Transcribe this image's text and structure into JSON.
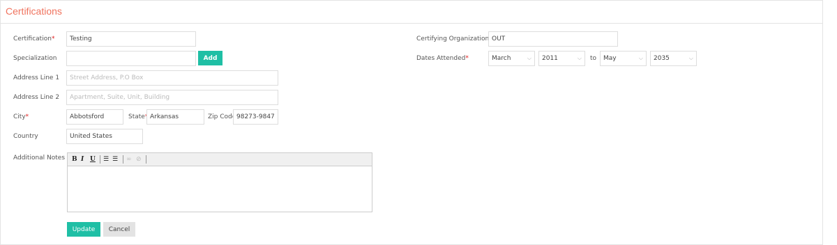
{
  "header": {
    "title": "Certifications"
  },
  "form": {
    "certification": {
      "label": "Certification",
      "value": "Testing"
    },
    "specialization": {
      "label": "Specialization",
      "value": "",
      "add_label": "Add"
    },
    "address1": {
      "label": "Address Line 1",
      "placeholder": "Street Address, P.O Box"
    },
    "address2": {
      "label": "Address Line 2",
      "placeholder": "Apartment, Suite, Unit, Building"
    },
    "city": {
      "label": "City",
      "value": "Abbotsford"
    },
    "state": {
      "label": "State",
      "value": "Arkansas"
    },
    "zip": {
      "label": "Zip Code",
      "value": "98273-9847"
    },
    "country": {
      "label": "Country",
      "value": "United States"
    },
    "notes": {
      "label": "Additional Notes"
    },
    "certifying_org": {
      "label": "Certifying Organization",
      "value": "OUT"
    },
    "dates": {
      "label": "Dates Attended",
      "from_month": "March",
      "from_year": "2011",
      "to_label": "to",
      "to_month": "May",
      "to_year": "2035"
    },
    "required_mark": "*"
  },
  "editor": {
    "bold": "B",
    "italic": "I",
    "underline": "U",
    "bullet_list": "☰",
    "number_list": "☰",
    "link": "∞",
    "unlink": "⊘"
  },
  "actions": {
    "update_label": "Update",
    "cancel_label": "Cancel"
  },
  "colors": {
    "accent": "#1fbfa5",
    "title": "#f0735e",
    "required": "#e01b1b"
  }
}
